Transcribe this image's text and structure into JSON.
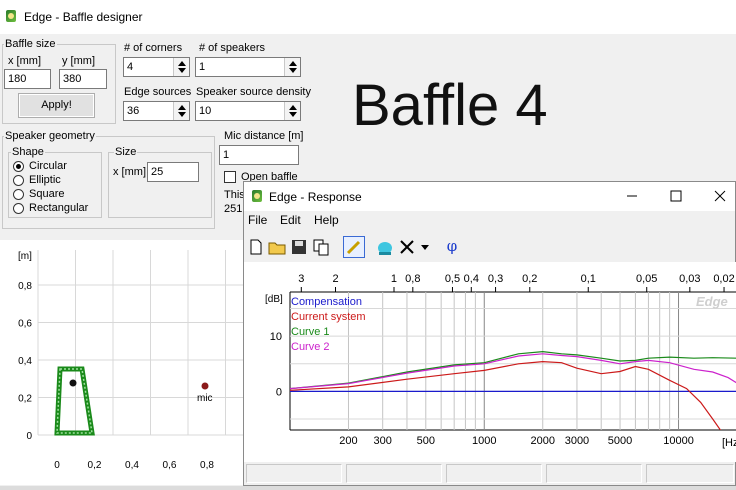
{
  "designer": {
    "title": "Edge - Baffle designer",
    "baffle_size": {
      "label": "Baffle size",
      "x_label": "x [mm]",
      "y_label": "y [mm]",
      "x_value": "180",
      "y_value": "380",
      "apply_label": "Apply!"
    },
    "corners": {
      "label": "# of corners",
      "value": "4"
    },
    "speakers": {
      "label": "# of speakers",
      "value": "1"
    },
    "edge_sources": {
      "label": "Edge sources",
      "value": "36"
    },
    "density": {
      "label": "Speaker source density",
      "value": "10"
    },
    "geometry": {
      "label": "Speaker geometry",
      "shape_label": "Shape",
      "shapes": [
        "Circular",
        "Elliptic",
        "Square",
        "Rectangular"
      ],
      "selected_shape": "Circular",
      "size_label": "Size",
      "size_x_label": "x [mm]",
      "size_value": "25"
    },
    "mic": {
      "label": "Mic distance [m]",
      "value": "1",
      "open_baffle_label": "Open baffle",
      "open_baffle_checked": false,
      "note_line1": "This",
      "note_line2": "251"
    },
    "overlay_text": "Baffle 4",
    "plot": {
      "ylabel": "[m]",
      "y_ticks": [
        "0,8",
        "0,6",
        "0,4",
        "0,2",
        "0"
      ],
      "x_ticks": [
        "0",
        "0,2",
        "0,4",
        "0,6",
        "0,8"
      ],
      "mic_label": "mic",
      "baffle_color": "#1a8a1a",
      "mic_color": "#8b1a1a"
    }
  },
  "response": {
    "title": "Edge - Response",
    "menu": [
      "File",
      "Edit",
      "Help"
    ],
    "toolbar_icons": [
      "new-file-icon",
      "open-folder-icon",
      "save-icon",
      "copy-icon",
      "pencil-icon",
      "color-icon",
      "delete-icon",
      "dropdown-arrow-icon",
      "phi-icon"
    ],
    "phi_label": "φ",
    "watermark": "Edge",
    "legend": [
      {
        "name": "Compensation",
        "color": "#1a1acc"
      },
      {
        "name": "Current system",
        "color": "#cc1a1a"
      },
      {
        "name": "Curve 1",
        "color": "#1a8a1a"
      },
      {
        "name": "Curve 2",
        "color": "#cc22cc"
      }
    ],
    "chart_data": {
      "type": "line",
      "ylabel": "[dB]",
      "xlabel": "[Hz]",
      "x_scale": "log",
      "xlim": [
        100,
        20000
      ],
      "ylim": [
        -7,
        18
      ],
      "y_ticks": [
        "10",
        "0"
      ],
      "x_ticks": [
        "200",
        "300",
        "500",
        "1000",
        "2000",
        "3000",
        "5000",
        "10000"
      ],
      "top_axis_ticks": [
        "3",
        "2",
        "1",
        "0,8",
        "0,5",
        "0,4",
        "0,3",
        "0,2",
        "0,1",
        "0,05",
        "0,03",
        "0,02"
      ],
      "series": [
        {
          "name": "Compensation",
          "x": [
            100,
            20000
          ],
          "y": [
            0,
            0
          ]
        },
        {
          "name": "Current system",
          "x": [
            100,
            200,
            400,
            700,
            1000,
            1500,
            2000,
            2500,
            3000,
            4000,
            5000,
            6000,
            7000,
            9000,
            11000,
            13000,
            15000,
            18000
          ],
          "y": [
            0.2,
            0.8,
            2.2,
            3.2,
            3.8,
            5.0,
            5.4,
            5.2,
            4.2,
            3.2,
            3.6,
            4.5,
            4.0,
            2.0,
            0.5,
            -2.0,
            -5.0,
            -9.0
          ]
        },
        {
          "name": "Curve 1",
          "x": [
            100,
            200,
            400,
            700,
            1000,
            1500,
            2000,
            2500,
            3000,
            4000,
            5000,
            6000,
            7000,
            9000,
            12000,
            15000,
            20000
          ],
          "y": [
            0.5,
            1.5,
            3.5,
            4.8,
            5.2,
            6.8,
            7.2,
            6.8,
            6.6,
            6.0,
            5.5,
            5.6,
            6.0,
            6.2,
            6.0,
            6.1,
            6.0
          ]
        },
        {
          "name": "Curve 2",
          "x": [
            100,
            200,
            400,
            700,
            1000,
            1500,
            2000,
            2500,
            3000,
            4000,
            5000,
            6000,
            7000,
            9000,
            12000,
            15000,
            18000,
            20000
          ],
          "y": [
            0.5,
            1.4,
            3.3,
            4.6,
            5.0,
            6.4,
            6.8,
            6.5,
            6.3,
            5.6,
            5.0,
            5.4,
            5.6,
            5.2,
            4.0,
            3.5,
            2.5,
            1.5
          ]
        }
      ]
    }
  }
}
